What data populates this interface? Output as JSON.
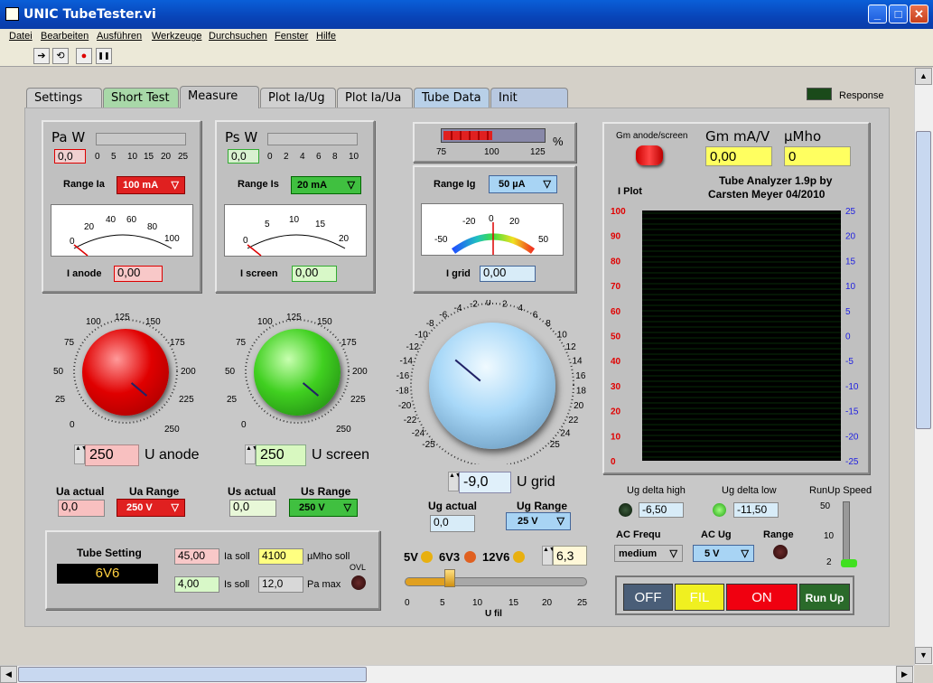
{
  "window": {
    "title": "UNIC TubeTester.vi",
    "min": "_",
    "max": "□",
    "close": "✕"
  },
  "menu": [
    "Datei",
    "Bearbeiten",
    "Ausführen",
    "Werkzeuge",
    "Durchsuchen",
    "Fenster",
    "Hilfe"
  ],
  "toolbar": {
    "run": "➔",
    "run_cont": "⟲",
    "abort": "●",
    "pause": "❚❚",
    "gm_icon": "Gm"
  },
  "tabs": [
    "Settings",
    "Short Test",
    "Measure",
    "Plot Ia/Ug",
    "Plot Ia/Ua",
    "Tube Data",
    "Init"
  ],
  "response_label": "Response",
  "anode_panel": {
    "title": "Pa W",
    "value": "0,0",
    "scale": [
      "0",
      "5",
      "10",
      "15",
      "20",
      "25"
    ],
    "range_label": "Range Ia",
    "range_value": "100 mA",
    "meter_ticks": [
      "0",
      "20",
      "40",
      "60",
      "80",
      "100"
    ],
    "i_label": "I anode",
    "i_value": "0,00"
  },
  "screen_panel": {
    "title": "Ps W",
    "value": "0,0",
    "scale": [
      "0",
      "2",
      "4",
      "6",
      "8",
      "10"
    ],
    "range_label": "Range Is",
    "range_value": "20 mA",
    "meter_ticks": [
      "0",
      "5",
      "10",
      "15",
      "20"
    ],
    "i_label": "I screen",
    "i_value": "0,00"
  },
  "bargraph": {
    "ticks": [
      "75",
      "100",
      "125"
    ],
    "unit": "%"
  },
  "grid_panel": {
    "range_label": "Range Ig",
    "range_value": "50 µA",
    "meter_ticks": [
      "-50",
      "-20",
      "0",
      "20",
      "50"
    ],
    "i_label": "I grid",
    "i_value": "0,00"
  },
  "anode_knob": {
    "ticks": [
      "0",
      "25",
      "50",
      "75",
      "100",
      "125",
      "150",
      "175",
      "200",
      "225",
      "250"
    ],
    "value": "250",
    "label": "U anode",
    "actual_label": "Ua actual",
    "actual_value": "0,0",
    "range_label": "Ua Range",
    "range_value": "250 V"
  },
  "screen_knob": {
    "ticks": [
      "0",
      "25",
      "50",
      "75",
      "100",
      "125",
      "150",
      "175",
      "200",
      "225",
      "250"
    ],
    "value": "250",
    "label": "U screen",
    "actual_label": "Us actual",
    "actual_value": "0,0",
    "range_label": "Us Range",
    "range_value": "250 V"
  },
  "grid_knob": {
    "ticks": [
      "-25",
      "-24",
      "-22",
      "-20",
      "-18",
      "-16",
      "-14",
      "-12",
      "-10",
      "-8",
      "-6",
      "-4",
      "-2",
      "0",
      "2",
      "4",
      "6",
      "8",
      "10",
      "12",
      "14",
      "16",
      "18",
      "20",
      "22",
      "24",
      "25"
    ],
    "value": "-9,0",
    "label": "U grid",
    "actual_label": "Ug actual",
    "actual_value": "0,0",
    "range_label": "Ug Range",
    "range_value": "25 V"
  },
  "tube_setting": {
    "title": "Tube Setting",
    "tube": "6V6",
    "ia_soll": "45,00",
    "ia_label": "Ia soll",
    "is_soll": "4,00",
    "is_label": "Is soll",
    "mho_soll": "4100",
    "mho_label": "µMho soll",
    "pa_max": "12,0",
    "pa_label": "Pa max",
    "ovl": "OVL"
  },
  "filament": {
    "v5": "5V",
    "v6": "6V3",
    "v12": "12V6",
    "value": "6,3",
    "ticks": [
      "0",
      "5",
      "10",
      "15",
      "20",
      "25"
    ],
    "label": "U fil",
    "fill": 0.25
  },
  "gm": {
    "switch_label": "Gm anode/screen",
    "mA_label": "Gm mA/V",
    "mA_value": "0,00",
    "mho_label": "µMho",
    "mho_value": "0",
    "title1": "Tube Analyzer 1.9p by",
    "title2": "Carsten Meyer 04/2010"
  },
  "plot": {
    "label": "I Plot",
    "left_ticks": [
      "100",
      "90",
      "80",
      "70",
      "60",
      "50",
      "40",
      "30",
      "20",
      "10",
      "0"
    ],
    "right_ticks": [
      "25",
      "20",
      "15",
      "10",
      "5",
      "0",
      "-5",
      "-10",
      "-15",
      "-20",
      "-25"
    ]
  },
  "controls": {
    "dh_label": "Ug delta high",
    "dh_value": "-6,50",
    "dl_label": "Ug delta low",
    "dl_value": "-11,50",
    "ru_label": "RunUp Speed",
    "ru_ticks": [
      "50",
      "10",
      "2"
    ],
    "acf_label": "AC Frequ",
    "acf_value": "medium",
    "acug_label": "AC Ug",
    "acug_value": "5 V",
    "range_label": "Range"
  },
  "buttons": {
    "off": "OFF",
    "fil": "FIL",
    "on": "ON",
    "runup": "Run Up"
  },
  "colors": {
    "red": "#e01010",
    "green": "#30c030",
    "blue": "#9ccff0",
    "yellow": "#ffff60"
  }
}
